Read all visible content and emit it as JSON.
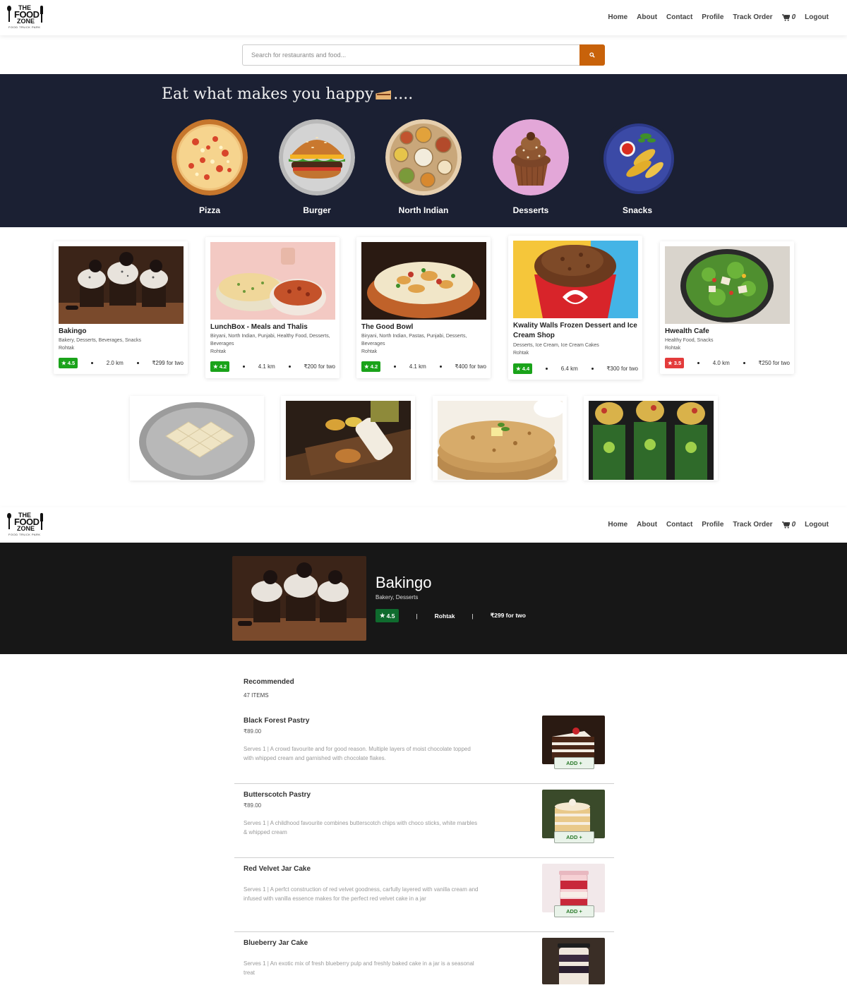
{
  "brand": {
    "line1": "THE",
    "line2": "FOOD",
    "line3": "ZONE",
    "tagline": "FOOD TRUCK PARK"
  },
  "nav": {
    "home": "Home",
    "about": "About",
    "contact": "Contact",
    "profile": "Profile",
    "track_order": "Track Order",
    "cart_count": "0",
    "logout": "Logout"
  },
  "search": {
    "placeholder": "Search for restaurants and food..."
  },
  "hero": {
    "title": "Eat what makes you happy",
    "suffix": "....",
    "categories": [
      {
        "label": "Pizza",
        "icon": "pizza-image"
      },
      {
        "label": "Burger",
        "icon": "burger-image"
      },
      {
        "label": "North Indian",
        "icon": "thali-image"
      },
      {
        "label": "Desserts",
        "icon": "cupcake-image"
      },
      {
        "label": "Snacks",
        "icon": "snacks-image"
      }
    ]
  },
  "restaurants": [
    {
      "name": "Bakingo",
      "cuisines": "Bakery, Desserts, Beverages, Snacks",
      "city": "Rohtak",
      "rating": "4.5",
      "distance": "2.0 km",
      "price": "₹299 for two",
      "rating_color": "#1aa31a"
    },
    {
      "name": "LunchBox - Meals and Thalis",
      "cuisines": "Biryani, North Indian, Punjabi, Healthy Food, Desserts, Beverages",
      "city": "Rohtak",
      "rating": "4.2",
      "distance": "4.1 km",
      "price": "₹200 for two",
      "rating_color": "#1aa31a"
    },
    {
      "name": "The Good Bowl",
      "cuisines": "Biryani, North Indian, Pastas, Punjabi, Desserts, Beverages",
      "city": "Rohtak",
      "rating": "4.2",
      "distance": "4.1 km",
      "price": "₹400 for two",
      "rating_color": "#1aa31a"
    },
    {
      "name": "Kwality Walls Frozen Dessert and Ice Cream Shop",
      "cuisines": "Desserts, Ice Cream, Ice Cream Cakes",
      "city": "Rohtak",
      "rating": "4.4",
      "distance": "6.4 km",
      "price": "₹300 for two",
      "rating_color": "#1aa31a"
    },
    {
      "name": "Hwealth Cafe",
      "cuisines": "Healthy Food, Snacks",
      "city": "Rohtak",
      "rating": "3.5",
      "distance": "4.0 km",
      "price": "₹250 for two",
      "rating_color": "#e33b3b"
    }
  ],
  "restaurant_page": {
    "name": "Bakingo",
    "cuisines": "Bakery, Desserts",
    "rating": "4.5",
    "city": "Rohtak",
    "price": "₹299 for two",
    "separator": "|",
    "rating_color": "#0f6b2e"
  },
  "menu": {
    "section_title": "Recommended",
    "count": "47 ITEMS",
    "add_label": "ADD +",
    "items": [
      {
        "name": "Black Forest Pastry",
        "price": "₹89.00",
        "desc": "Serves 1 | A crowd favourite and for good reason. Multiple layers of moist chocolate topped with whipped cream and garnished with chocolate flakes."
      },
      {
        "name": "Butterscotch Pastry",
        "price": "₹89.00",
        "desc": "Serves 1 | A childhood favourite combines butterscotch chips with choco sticks, white marbles & whipped cream"
      },
      {
        "name": "Red Velvet Jar Cake",
        "price": "",
        "desc": "Serves 1 | A perfct construction of red velvet goodness, carfully layered with vanilla cream and infused with vanilla essence makes for the perfect red velvet cake in a jar"
      },
      {
        "name": "Blueberry Jar Cake",
        "price": "",
        "desc": "Serves 1 | An exotic mix of fresh blueberry pulp and freshly baked cake in a jar is a seasonal treat"
      }
    ]
  },
  "colors": {
    "accent": "#c8620a",
    "hero_bg": "#1b2033",
    "header_bg": "#171717"
  }
}
